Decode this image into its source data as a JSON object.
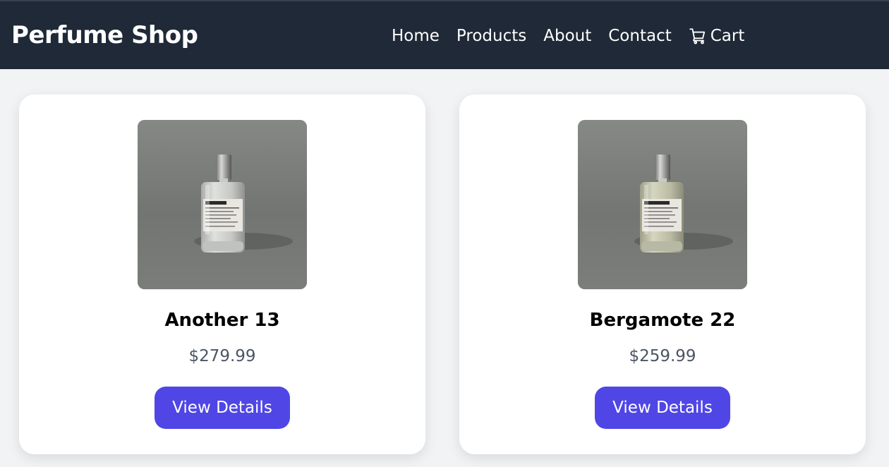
{
  "header": {
    "brand": "Perfume Shop",
    "nav": {
      "home": "Home",
      "products": "Products",
      "about": "About",
      "contact": "Contact",
      "cart": "Cart"
    }
  },
  "products": [
    {
      "name": "Another 13",
      "price": "$279.99",
      "button": "View Details",
      "label_text": "ANOTHER 13"
    },
    {
      "name": "Bergamote 22",
      "price": "$259.99",
      "button": "View Details",
      "label_text": "BERGAMOTE 22"
    }
  ],
  "colors": {
    "navbar": "#1f2937",
    "background": "#f2f3f5",
    "accent": "#4f46e5",
    "price": "#4b5563"
  },
  "icons": {
    "cart": "shopping-cart-icon"
  }
}
